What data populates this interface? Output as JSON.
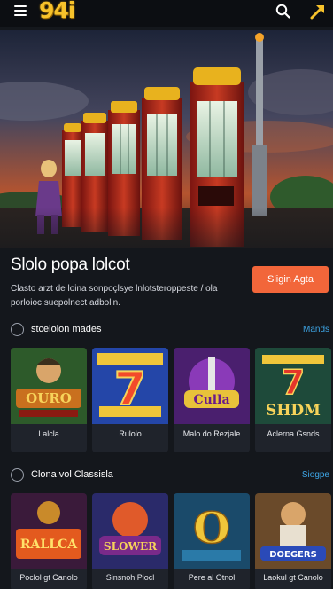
{
  "header": {
    "logo_text": "94i",
    "menu_icon": "hamburger-icon",
    "search_icon": "search-icon",
    "arrow_icon": "arrow-up-right-icon",
    "accent": "#f7c22b"
  },
  "hero": {
    "title": "Slolo popa lolcot",
    "description": "Clasto arzt de loina sonpoçlsye lnlotsteroppeste / ola porloioc suepolnect adbolin.",
    "cta_label": "Sligin Agta",
    "cta_color": "#f2663a"
  },
  "sections": [
    {
      "title": "stceloion mades",
      "link": "Mands",
      "cards": [
        {
          "label": "Lalcla",
          "art": "OURO"
        },
        {
          "label": "Rulolo",
          "art": "7"
        },
        {
          "label": "Malo do Rezjale",
          "art": "Culla"
        },
        {
          "label": "Aclerna Gsnds",
          "art": "SHDM"
        }
      ]
    },
    {
      "title": "Clona vol Classisla",
      "link": "Siogpe",
      "cards": [
        {
          "label": "Poclol gt Canolo",
          "art": "RALLCA"
        },
        {
          "label": "Sinsnoh Piocl",
          "art": "SLOWER"
        },
        {
          "label": "Pere al Otnol",
          "art": "O"
        },
        {
          "label": "Laokul gt Canolo",
          "art": "DOEGERS"
        }
      ]
    }
  ]
}
